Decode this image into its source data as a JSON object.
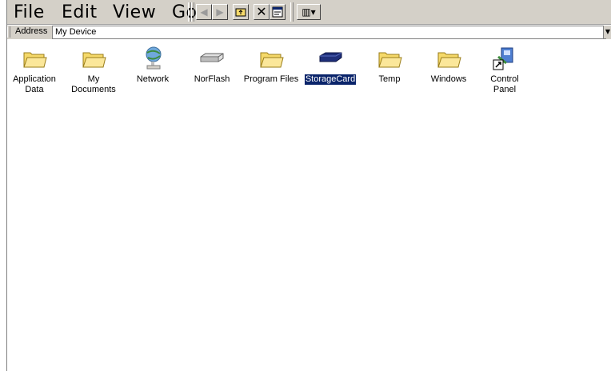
{
  "menu": {
    "file": "File",
    "edit": "Edit",
    "view": "View",
    "go": "Go"
  },
  "toolbar": {
    "back_icon": "back-arrow-icon",
    "forward_icon": "forward-arrow-icon",
    "up_icon": "up-folder-icon",
    "delete_icon": "delete-icon",
    "properties_icon": "properties-icon",
    "views_icon": "views-icon"
  },
  "address": {
    "label": "Address",
    "value": "My Device"
  },
  "items": [
    {
      "label_line1": "Application",
      "label_line2": "Data",
      "icon": "folder-icon"
    },
    {
      "label_line1": "My",
      "label_line2": "Documents",
      "icon": "folder-icon"
    },
    {
      "label_line1": "Network",
      "label_line2": "",
      "icon": "network-icon"
    },
    {
      "label_line1": "NorFlash",
      "label_line2": "",
      "icon": "drive-icon"
    },
    {
      "label_line1": "Program Files",
      "label_line2": "",
      "icon": "folder-icon"
    },
    {
      "label_line1": "StorageCard",
      "label_line2": "",
      "icon": "storage-card-icon",
      "selected": true
    },
    {
      "label_line1": "Temp",
      "label_line2": "",
      "icon": "folder-icon"
    },
    {
      "label_line1": "Windows",
      "label_line2": "",
      "icon": "folder-icon"
    },
    {
      "label_line1": "Control",
      "label_line2": "Panel",
      "icon": "control-panel-shortcut-icon"
    }
  ],
  "colors": {
    "selection": "#0a246a",
    "chrome": "#d4d0c8",
    "folder": "#f5d96a"
  }
}
